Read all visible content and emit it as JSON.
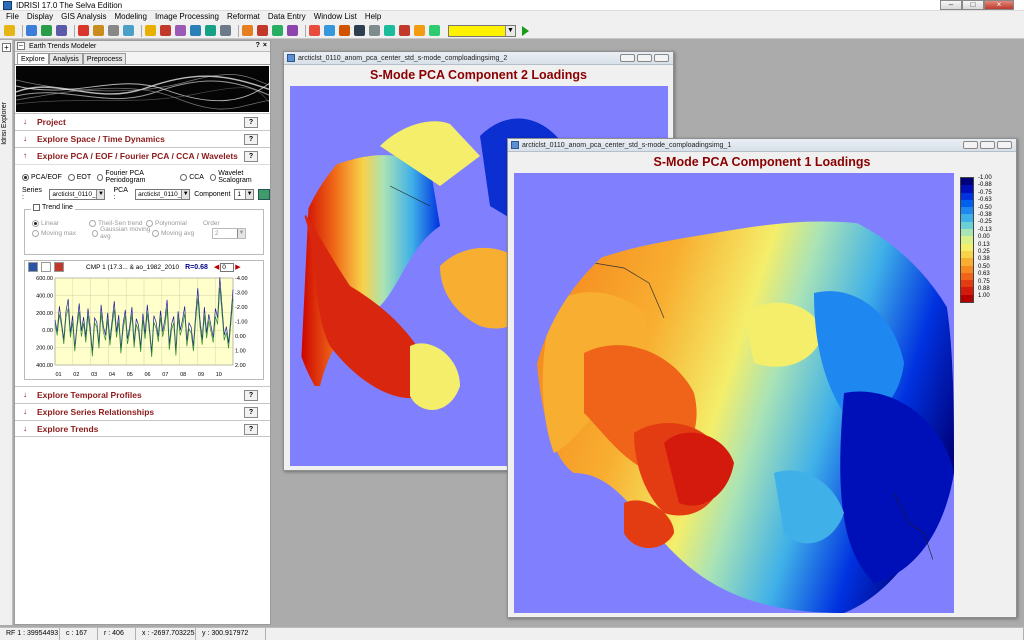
{
  "app": {
    "title": "IDRISI 17.0     The Selva Edition"
  },
  "menu": [
    "File",
    "Display",
    "GIS Analysis",
    "Modeling",
    "Image Processing",
    "Reformat",
    "Data Entry",
    "Window List",
    "Help"
  ],
  "toolbar": {
    "combo_value": ""
  },
  "left_strip": {
    "label": "Idrisi Explorer"
  },
  "etm": {
    "title": "Earth Trends Modeler",
    "header_controls": [
      "?",
      "×"
    ],
    "tabs": [
      "Explore",
      "Analysis",
      "Preprocess"
    ],
    "active_tab": "Explore",
    "sections": {
      "project": "Project",
      "space_time": "Explore Space / Time Dynamics",
      "pca": "Explore PCA / EOF / Fourier PCA / CCA / Wavelets",
      "temporal": "Explore Temporal Profiles",
      "series_rel": "Explore Series Relationships",
      "trends": "Explore Trends"
    },
    "help_label": "?",
    "pca_options": [
      "PCA/EOF",
      "EOT",
      "Fourier PCA Periodogram",
      "CCA",
      "Wavelet Scalogram"
    ],
    "pca_selected": "PCA/EOF",
    "series_label": "Series :",
    "series_value": "arcticlst_0110_ano",
    "pca_label": "PCA :",
    "pca_value": "arcticlst_0110_ano",
    "component_label": "Component",
    "component_value": "1",
    "trend_line_label": "Trend line",
    "trend_options": {
      "linear": "Linear",
      "theil_sen": "Theil-Sen trend",
      "polynomial": "Polynomial",
      "order_label": "Order",
      "moving_max": "Moving max",
      "gaussian": "Gaussian moving avg",
      "moving_avg": "Moving avg",
      "order_value": "2"
    },
    "chart": {
      "caption": "CMP 1 (17.3... & ao_1982_2010",
      "r_value": "R=0.68",
      "spin_value": "0"
    }
  },
  "chart_data": {
    "type": "line",
    "title": "CMP 1 (17.3... & ao_1982_2010",
    "x_ticks": [
      "01",
      "02",
      "03",
      "04",
      "05",
      "06",
      "07",
      "08",
      "09",
      "10"
    ],
    "y_left_ticks": [
      "600.00",
      "400.00",
      "200.00",
      "0.00",
      "200.00",
      "400.00"
    ],
    "y_right_ticks": [
      "-4.00",
      "-3.00",
      "-2.00",
      "-1.00",
      "0.00",
      "1.00",
      "2.00"
    ],
    "ylim_left": [
      -500,
      700
    ],
    "ylim_right": [
      2.2,
      -4.2
    ],
    "grid": true,
    "series": [
      {
        "color": "#1f1f9c",
        "axis": "left",
        "values": [
          120,
          -40,
          310,
          80,
          -150,
          240,
          410,
          -60,
          180,
          -260,
          60,
          350,
          -30,
          160,
          -120,
          280,
          20,
          -320,
          150,
          90,
          -210,
          330,
          40,
          -90,
          220,
          -160,
          110,
          380,
          -50,
          190,
          -280,
          70,
          260,
          -140,
          30,
          300,
          -190,
          140,
          50,
          -260,
          210,
          -70,
          330,
          10,
          -330,
          180,
          90,
          -110,
          250,
          -40,
          130,
          400,
          -220,
          60,
          170,
          -300,
          240,
          -20,
          120,
          310,
          -170,
          80,
          20,
          -240,
          190,
          560,
          120,
          -150,
          300,
          -60,
          200,
          40,
          -120,
          280,
          150,
          710,
          320,
          -90,
          30,
          -200,
          150,
          540
        ]
      },
      {
        "color": "#2e8b2e",
        "axis": "left",
        "values": [
          60,
          -90,
          200,
          30,
          -210,
          160,
          280,
          -120,
          90,
          -310,
          10,
          230,
          -110,
          80,
          -190,
          180,
          -60,
          -380,
          80,
          20,
          -270,
          220,
          -40,
          -160,
          130,
          -230,
          40,
          260,
          -120,
          100,
          -340,
          -10,
          170,
          -210,
          -40,
          200,
          -260,
          60,
          -30,
          -320,
          120,
          -140,
          220,
          -60,
          -390,
          90,
          10,
          -180,
          160,
          -110,
          40,
          280,
          -290,
          -20,
          80,
          -370,
          150,
          -90,
          30,
          210,
          -240,
          0,
          -60,
          -310,
          100,
          420,
          30,
          -220,
          190,
          -130,
          110,
          -40,
          -190,
          170,
          60,
          560,
          210,
          -160,
          -50,
          -270,
          60,
          410
        ]
      }
    ]
  },
  "windows": {
    "comp2": {
      "title": "arcticlst_0110_anom_pca_center_std_s-mode_comploadingsimg_2",
      "heading": "S-Mode PCA Component 2 Loadings"
    },
    "comp1": {
      "title": "arcticlst_0110_anom_pca_center_std_s-mode_comploadingsimg_1",
      "heading": "S-Mode PCA Component 1 Loadings",
      "legend": [
        "-1.00",
        "-0.88",
        "-0.75",
        "-0.63",
        "-0.50",
        "-0.38",
        "-0.25",
        "-0.13",
        "0.00",
        "0.13",
        "0.25",
        "0.38",
        "0.50",
        "0.63",
        "0.75",
        "0.88",
        "1.00"
      ],
      "legend_colors": [
        "#00007a",
        "#0010b8",
        "#0032e0",
        "#0060f0",
        "#1e88f0",
        "#3fb0e8",
        "#6ccfd6",
        "#a9e3b6",
        "#d8ef8a",
        "#f4ee6a",
        "#f8d24a",
        "#f8ae30",
        "#f58a20",
        "#ef6418",
        "#e43c12",
        "#d41a0c",
        "#b50000"
      ]
    }
  },
  "status": {
    "rf": "RF  1 : 39954493",
    "c": "c :  167",
    "r": "r :  406",
    "x": "x : -2697.703225",
    "y": "y :  300.917972"
  }
}
